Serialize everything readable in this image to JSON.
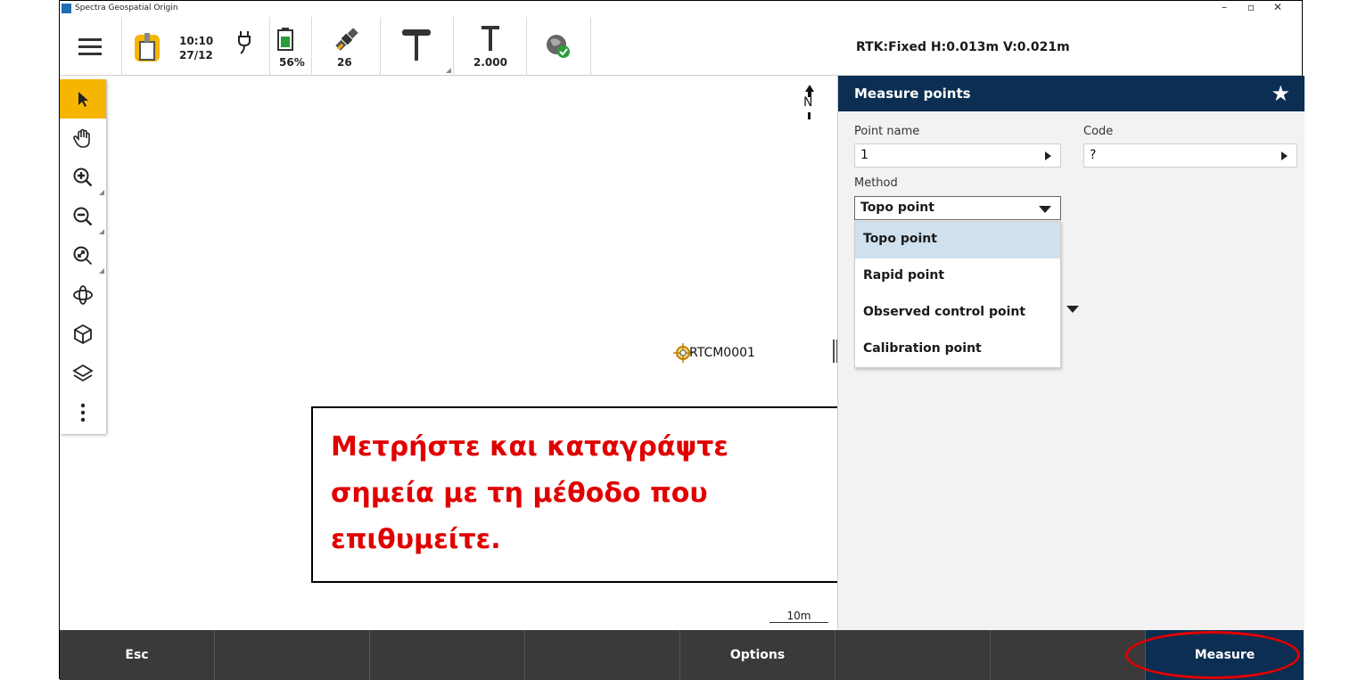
{
  "window": {
    "title": "Spectra Geospatial Origin",
    "minimize": "–",
    "restore": "▫",
    "close": "✕"
  },
  "statusbar": {
    "time": "10:10",
    "date": "27/12",
    "battery": "56%",
    "satellites": "26",
    "antenna_height": "2.000",
    "rtk_status": "RTK:Fixed H:0.013m V:0.021m"
  },
  "map": {
    "north_label": "N",
    "point_label": "RTCM0001",
    "scale_label": "10m",
    "callout_line1": "Μετρήστε και καταγράψτε",
    "callout_line2": "σημεία με τη μέθοδο που",
    "callout_line3": "επιθυμείτε."
  },
  "panel": {
    "title": "Measure points",
    "point_name_label": "Point name",
    "point_name_value": "1",
    "code_label": "Code",
    "code_value": "?",
    "method_label": "Method",
    "method_value": "Topo point",
    "method_options": [
      "Topo point",
      "Rapid point",
      "Observed control point",
      "Calibration point"
    ]
  },
  "bottombar": {
    "esc": "Esc",
    "options": "Options",
    "measure": "Measure"
  },
  "colors": {
    "accent": "#f6b500",
    "header": "#0b2e52",
    "callout_text": "#e00000"
  }
}
